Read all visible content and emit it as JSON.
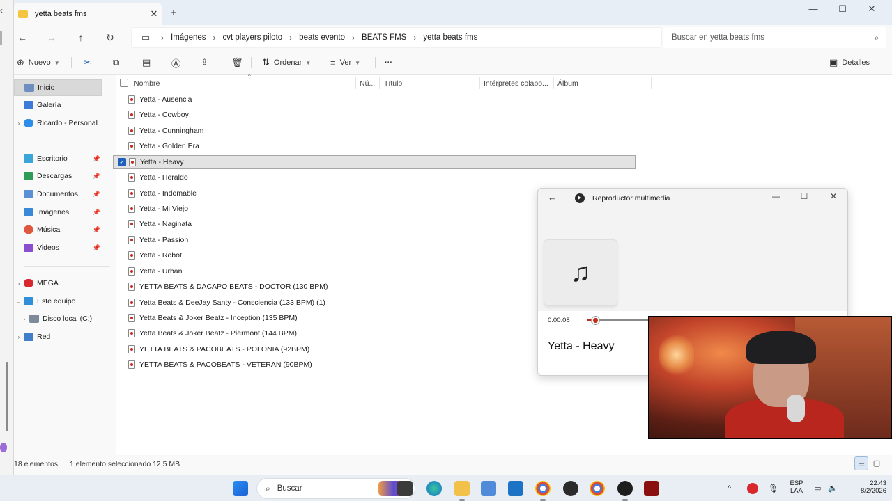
{
  "explorer": {
    "tab_title": "yetta beats fms",
    "breadcrumb": [
      "Imágenes",
      "cvt players  piloto",
      "beats evento",
      "BEATS FMS",
      "yetta beats fms"
    ],
    "search_placeholder": "Buscar en yetta beats fms",
    "toolbar": {
      "new_label": "Nuevo",
      "sort_label": "Ordenar",
      "view_label": "Ver",
      "more_label": "···",
      "details_label": "Detalles"
    },
    "sidebar": [
      {
        "label": "Inicio",
        "icon": "home-icon",
        "selected": true
      },
      {
        "label": "Galería",
        "icon": "gallery-icon"
      },
      {
        "label": "Ricardo - Personal",
        "icon": "onedrive-icon"
      },
      {
        "label": "Escritorio",
        "icon": "desktop-icon"
      },
      {
        "label": "Descargas",
        "icon": "downloads-icon"
      },
      {
        "label": "Documentos",
        "icon": "documents-icon"
      },
      {
        "label": "Imágenes",
        "icon": "pictures-icon"
      },
      {
        "label": "Música",
        "icon": "music-icon"
      },
      {
        "label": "Videos",
        "icon": "videos-icon"
      },
      {
        "label": "MEGA",
        "icon": "mega-icon"
      },
      {
        "label": "Este equipo",
        "icon": "this-pc-icon"
      },
      {
        "label": "Disco local (C:)",
        "icon": "drive-icon"
      },
      {
        "label": "Red",
        "icon": "network-icon"
      }
    ],
    "columns": {
      "name": "Nombre",
      "number": "Nú...",
      "title": "Título",
      "artists": "Intérpretes colabo...",
      "album": "Álbum"
    },
    "files": [
      "Yetta - Ausencia",
      "Yetta - Cowboy",
      "Yetta - Cunningham",
      "Yetta - Golden Era",
      "Yetta - Heavy",
      "Yetta - Heraldo",
      "Yetta - Indomable",
      "Yetta - Mi Viejo",
      "Yetta - Naginata",
      "Yetta - Passion",
      "Yetta - Robot",
      "Yetta - Urban",
      "YETTA BEATS & DACAPO BEATS - DOCTOR (130 BPM)",
      "Yetta Beats & DeeJay Santy - Consciencia (133 BPM) (1)",
      "Yetta Beats & Joker Beatz - Inception (135 BPM)",
      "Yetta Beats & Joker Beatz - Piermont (144 BPM)",
      "YETTA BEATS & PACOBEATS - POLONIA (92BPM)",
      "YETTA BEATS & PACOBEATS - VETERAN (90BPM)"
    ],
    "selected_file": "Yetta - Heavy",
    "status": {
      "count": "18 elementos",
      "selection": "1 elemento seleccionado  12,5 MB"
    }
  },
  "player": {
    "title": "Reproductor multimedia",
    "elapsed": "0:00:08",
    "progress": 0.04,
    "song": "Yetta - Heavy"
  },
  "taskbar": {
    "search_label": "Buscar",
    "lang_top": "ESP",
    "lang_bottom": "LAA",
    "time": "22:43",
    "date": "8/2/2026"
  },
  "colors": {
    "accent": "#1f5fbd",
    "player_accent": "#c42b1c"
  }
}
